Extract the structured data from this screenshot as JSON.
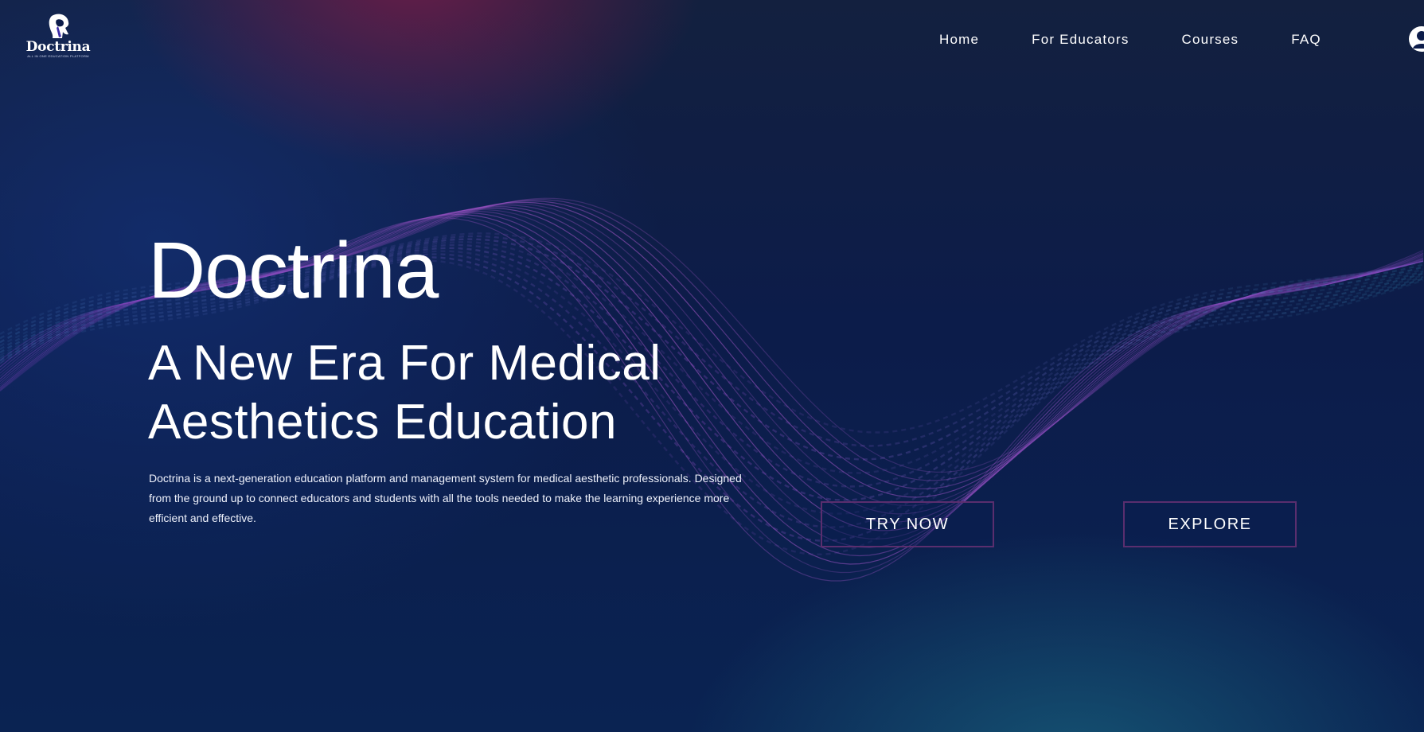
{
  "brand": {
    "name": "Doctrina",
    "tagline": "ALL IN ONE EDUCATION PLATFORM"
  },
  "nav": {
    "items": [
      {
        "label": "Home"
      },
      {
        "label": "For Educators"
      },
      {
        "label": "Courses"
      },
      {
        "label": "FAQ"
      }
    ],
    "account_icon": "user-circle-icon"
  },
  "hero": {
    "title": "Doctrina",
    "subtitle_line1": "A New Era For Medical",
    "subtitle_line2": "Aesthetics Education",
    "description": "Doctrina is a next-generation education platform and management system for medical aesthetic professionals. Designed from the ground up to connect educators and students with all the tools needed to make the learning experience more efficient and effective.",
    "primary_cta": "TRY NOW",
    "secondary_cta": "EXPLORE"
  },
  "colors": {
    "background": "#0c1c4a",
    "wave": "#a64dc7",
    "button_border": "#5a2e6e",
    "text": "#ffffff"
  }
}
